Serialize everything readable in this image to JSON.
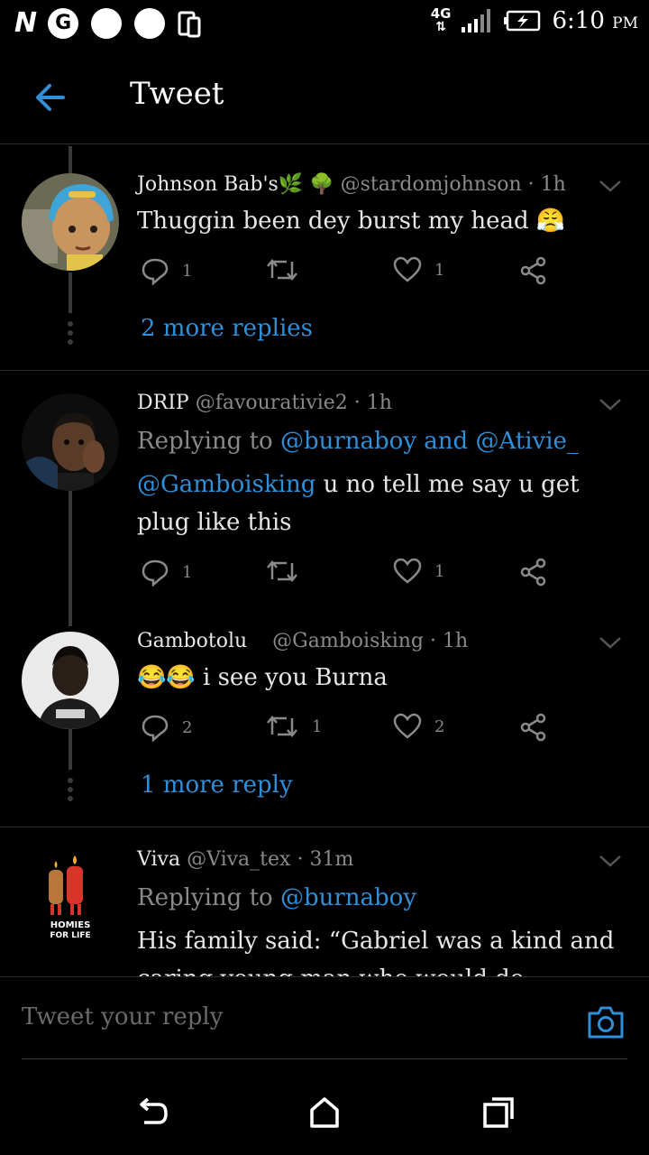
{
  "status_bar": {
    "left_glyph_1": "N",
    "left_glyph_2": "G",
    "network_type": "4G",
    "time": "6:10",
    "ampm": "PM"
  },
  "header": {
    "title": "Tweet"
  },
  "tweets": [
    {
      "name": "Johnson Bab's🌿 🌳",
      "handle": "@stardomjohnson",
      "time": "1h",
      "text": "Thuggin been dey burst my head 😤",
      "replies": "1",
      "retweets": "",
      "likes": "1",
      "more_replies": "2 more replies"
    },
    {
      "name": "DRIP",
      "handle": "@favourativie2",
      "time": "1h",
      "replying_prefix": "Replying to",
      "replying_1": "@burnaboy",
      "replying_and": "and",
      "replying_2": "@Ativie_",
      "mention": "@Gamboisking",
      "text": "u no tell me say u get plug like this",
      "replies": "1",
      "retweets": "",
      "likes": "1"
    },
    {
      "name": "Gambotolu",
      "handle": "@Gamboisking",
      "time": "1h",
      "text": "😂😂 i see you Burna",
      "replies": "2",
      "retweets": "1",
      "likes": "2",
      "more_replies": "1 more reply"
    },
    {
      "name": "Viva",
      "handle": "@Viva_tex",
      "time": "31m",
      "replying_prefix": "Replying to",
      "replying_1": "@burnaboy",
      "text": "His family said: “Gabriel was a kind and caring young man who would do",
      "avatar_logo_text": "HOMIES FOR LIFE"
    }
  ],
  "reply_bar": {
    "placeholder": "Tweet your reply"
  },
  "colors": {
    "accent": "#2f8fd8",
    "muted": "#8a8a8a",
    "background": "#000000"
  },
  "icons": [
    "back-arrow-icon",
    "chevron-down-icon",
    "reply-icon",
    "retweet-icon",
    "heart-icon",
    "share-icon",
    "camera-icon",
    "nav-back-icon",
    "nav-home-icon",
    "nav-recents-icon"
  ]
}
